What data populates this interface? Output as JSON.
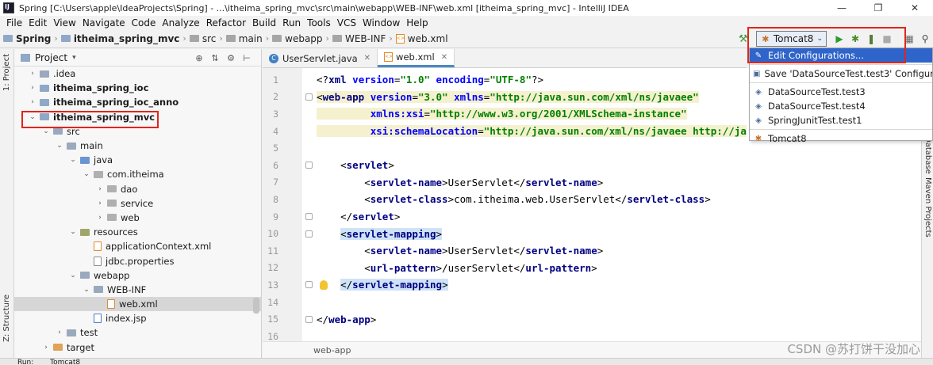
{
  "window": {
    "title": "Spring [C:\\Users\\apple\\IdeaProjects\\Spring] - ...\\itheima_spring_mvc\\src\\main\\webapp\\WEB-INF\\web.xml [itheima_spring_mvc] - IntelliJ IDEA",
    "minimize": "—",
    "maximize": "❐",
    "close": "✕"
  },
  "menu": [
    "File",
    "Edit",
    "View",
    "Navigate",
    "Code",
    "Analyze",
    "Refactor",
    "Build",
    "Run",
    "Tools",
    "VCS",
    "Window",
    "Help"
  ],
  "breadcrumb": [
    "Spring",
    "itheima_spring_mvc",
    "src",
    "main",
    "webapp",
    "WEB-INF",
    "web.xml"
  ],
  "toolbar": {
    "run_config": "Tomcat8",
    "hammer_icon": "hammer-icon",
    "run_icon": "▶",
    "debug_icon": "✱",
    "coverage_icon": "❚",
    "stop_icon": "■",
    "structure_icon": "▦",
    "search_icon": "⚲"
  },
  "side_tabs": {
    "project": "1: Project",
    "structure": "Z: Structure",
    "database": "Database",
    "maven": "Maven Projects"
  },
  "project_panel": {
    "title": "Project",
    "tree": [
      {
        "label": ".idea",
        "depth": 1,
        "arrow": "›",
        "icon": "folder"
      },
      {
        "label": "itheima_spring_ioc",
        "depth": 1,
        "arrow": "›",
        "icon": "module",
        "bold": true
      },
      {
        "label": "itheima_spring_ioc_anno",
        "depth": 1,
        "arrow": "›",
        "icon": "module",
        "bold": true
      },
      {
        "label": "itheima_spring_mvc",
        "depth": 1,
        "arrow": "⌄",
        "icon": "module",
        "bold": true
      },
      {
        "label": "src",
        "depth": 2,
        "arrow": "⌄",
        "icon": "folder"
      },
      {
        "label": "main",
        "depth": 3,
        "arrow": "⌄",
        "icon": "folder"
      },
      {
        "label": "java",
        "depth": 4,
        "arrow": "⌄",
        "icon": "src"
      },
      {
        "label": "com.itheima",
        "depth": 5,
        "arrow": "⌄",
        "icon": "package"
      },
      {
        "label": "dao",
        "depth": 6,
        "arrow": "›",
        "icon": "package"
      },
      {
        "label": "service",
        "depth": 6,
        "arrow": "›",
        "icon": "package"
      },
      {
        "label": "web",
        "depth": 6,
        "arrow": "›",
        "icon": "package"
      },
      {
        "label": "resources",
        "depth": 4,
        "arrow": "⌄",
        "icon": "res"
      },
      {
        "label": "applicationContext.xml",
        "depth": 5,
        "arrow": "",
        "icon": "xml"
      },
      {
        "label": "jdbc.properties",
        "depth": 5,
        "arrow": "",
        "icon": "props"
      },
      {
        "label": "webapp",
        "depth": 4,
        "arrow": "⌄",
        "icon": "folder"
      },
      {
        "label": "WEB-INF",
        "depth": 5,
        "arrow": "⌄",
        "icon": "folder"
      },
      {
        "label": "web.xml",
        "depth": 6,
        "arrow": "",
        "icon": "xml",
        "selected": true
      },
      {
        "label": "index.jsp",
        "depth": 5,
        "arrow": "",
        "icon": "jsp"
      },
      {
        "label": "test",
        "depth": 3,
        "arrow": "›",
        "icon": "folder"
      },
      {
        "label": "target",
        "depth": 2,
        "arrow": "›",
        "icon": "orange"
      }
    ]
  },
  "editor_tabs": [
    {
      "label": "UserServlet.java",
      "active": false
    },
    {
      "label": "web.xml",
      "active": true
    }
  ],
  "code_lines": [
    {
      "n": "1",
      "html": "<span class=\"plain\">&lt;?</span><span class=\"tag\">xml </span><span class=\"attr\">version</span><span class=\"plain\">=</span><span class=\"val\">\"1.0\" </span><span class=\"attr\">encoding</span><span class=\"plain\">=</span><span class=\"val\">\"UTF-8\"</span><span class=\"plain\">?&gt;</span>"
    },
    {
      "n": "2",
      "html": "<span class=\"plain\">&lt;</span><span class=\"tag\">web-app </span><span class=\"attr\">version</span><span class=\"plain\">=</span><span class=\"val\">\"3.0\" </span><span class=\"attr\">xmlns</span><span class=\"plain\">=</span><span class=\"val\">\"http://java.sun.com/xml/ns/javaee\"</span>"
    },
    {
      "n": "3",
      "html": "<span class=\"attr\">         xmlns:xsi</span><span class=\"plain\">=</span><span class=\"val\">\"http://www.w3.org/2001/XMLSchema-instance\"</span>"
    },
    {
      "n": "4",
      "html": "<span class=\"attr\">         xsi:schemaLocation</span><span class=\"plain\">=</span><span class=\"val\">\"http://java.sun.com/xml/ns/javaee http://ja</span>"
    },
    {
      "n": "5",
      "html": ""
    },
    {
      "n": "6",
      "html": "<span class=\"plain\">    &lt;</span><span class=\"tag\">servlet</span><span class=\"plain\">&gt;</span>"
    },
    {
      "n": "7",
      "html": "<span class=\"plain\">        &lt;</span><span class=\"tag\">servlet-name</span><span class=\"plain\">&gt;UserServlet&lt;/</span><span class=\"tag\">servlet-name</span><span class=\"plain\">&gt;</span>"
    },
    {
      "n": "8",
      "html": "<span class=\"plain\">        &lt;</span><span class=\"tag\">servlet-class</span><span class=\"plain\">&gt;com.itheima.web.UserServlet&lt;/</span><span class=\"tag\">servlet-class</span><span class=\"plain\">&gt;</span>"
    },
    {
      "n": "9",
      "html": "<span class=\"plain\">    &lt;/</span><span class=\"tag\">servlet</span><span class=\"plain\">&gt;</span>"
    },
    {
      "n": "10",
      "html": "<span class=\"plain\">    </span><span class=\"hl-blue\"><span class=\"plain\">&lt;</span><span class=\"tag\">servlet-mapping</span><span class=\"plain\">&gt;</span></span>"
    },
    {
      "n": "11",
      "html": "<span class=\"plain\">        &lt;</span><span class=\"tag\">servlet-name</span><span class=\"plain\">&gt;UserServlet&lt;/</span><span class=\"tag\">servlet-name</span><span class=\"plain\">&gt;</span>"
    },
    {
      "n": "12",
      "html": "<span class=\"plain\">        &lt;</span><span class=\"tag\">url-pattern</span><span class=\"plain\">&gt;/userServlet&lt;/</span><span class=\"tag\">url-pattern</span><span class=\"plain\">&gt;</span>"
    },
    {
      "n": "13",
      "html": "<span class=\"plain\">    </span><span class=\"hl-blue\"><span class=\"plain\">&lt;/</span><span class=\"tag\">servlet-mapping</span><span class=\"plain\">&gt;</span></span>"
    },
    {
      "n": "14",
      "html": ""
    },
    {
      "n": "15",
      "html": "<span class=\"plain\">&lt;/</span><span class=\"tag\">web-app</span><span class=\"plain\">&gt;</span>"
    },
    {
      "n": "16",
      "html": ""
    }
  ],
  "editor_footer": "web-app",
  "dropdown": {
    "items": [
      {
        "label": "Edit Configurations...",
        "icon": "edit-config-icon",
        "glyph": "✎",
        "selected": true
      },
      {
        "sep": true
      },
      {
        "label": "Save 'DataSourceTest.test3' Configuration",
        "icon": "save-icon",
        "glyph": "▣"
      },
      {
        "sep": true
      },
      {
        "label": "DataSourceTest.test3",
        "icon": "test-icon",
        "glyph": "◈"
      },
      {
        "label": "DataSourceTest.test4",
        "icon": "test-icon",
        "glyph": "◈"
      },
      {
        "label": "SpringJunitTest.test1",
        "icon": "test-icon",
        "glyph": "◈"
      },
      {
        "sep": true
      },
      {
        "label": "Tomcat8",
        "icon": "tomcat-icon",
        "glyph": "✱"
      }
    ]
  },
  "bottom": {
    "run_tab": "Run:",
    "tomcat_tab": "Tomcat8"
  },
  "watermark": "CSDN @苏打饼干没加心",
  "colors": {
    "highlight_red": "#e1251b",
    "selection_blue": "#2f65ca",
    "tag": "#000080",
    "string": "#008000",
    "attr": "#0000ff"
  }
}
